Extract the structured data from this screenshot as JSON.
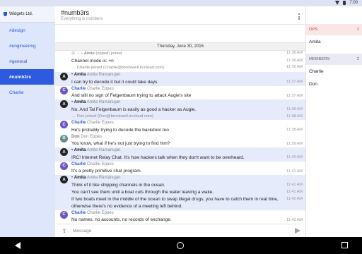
{
  "status": {
    "time": "7:00"
  },
  "server": {
    "name": "Widgets Ltd."
  },
  "channels": [
    {
      "label": "#design"
    },
    {
      "label": "#engineering"
    },
    {
      "label": "#general"
    },
    {
      "label": "#numb3rs"
    },
    {
      "label": "Charlie"
    }
  ],
  "header": {
    "title": "#numb3rs",
    "topic": "Everything is numbers"
  },
  "date_separator": "Thursday, June 30, 2016",
  "messages": {
    "m1": {
      "who": "Amita",
      "text": "(opped) joined",
      "time": "11:36 AM"
    },
    "m2": {
      "text": "Channel mode is: +n",
      "time": "11:36 AM"
    },
    "m3": {
      "text": "Charlie joined (Charlie@brockwell.irccloud.com)",
      "time": "11:36 AM"
    },
    "m4": {
      "avatar": "A",
      "nick": "Amita",
      "real": "Amita Ramanujan",
      "text": "I can try to decode it but it could take days",
      "time": "11:37 AM"
    },
    "m5": {
      "avatar": "C",
      "nick": "Charlie",
      "real": "Charlie Eppes",
      "text": "And still no sign of Felgenbaum trying to attack Augie's site",
      "time": "11:37 AM"
    },
    "m6": {
      "avatar": "A",
      "nick": "Amita",
      "real": "Amita Ramanujan",
      "text": "No. And Tal Felgenbaum is easily as good a hacker as Augie.",
      "time": "11:38 AM"
    },
    "m7": {
      "text": "Don joined (Don@brockwell.irccloud.com)",
      "time": "11:38 AM"
    },
    "m8": {
      "avatar": "C",
      "nick": "Charlie",
      "real": "Charlie Eppes",
      "text": "He's probably trying to decode the backdoor too",
      "time": "11:38 AM"
    },
    "m9": {
      "avatar": "D",
      "nick": "Don",
      "real": "Don Eppes",
      "text": "You know, what if he's not just trying to find him?",
      "time": "11:39 AM"
    },
    "m10": {
      "avatar": "A",
      "nick": "Amita",
      "real": "Amita Ramanujan",
      "text": "IRC! Internet Relay Chat. It's how hackers talk when they don't want to be overheard.",
      "time": "11:40 AM"
    },
    "m11": {
      "avatar": "C",
      "nick": "Charlie",
      "real": "Charlie Eppes",
      "text": "It's a pretty primitive chat program.",
      "time": "11:41 AM"
    },
    "m12": {
      "avatar": "A",
      "nick": "Amita",
      "real": "Amita Ramanujan",
      "text1": "Think of it like shipping channels in the ocean.",
      "time1": "11:41 AM",
      "text2": "You can't see them until a boat cuts through the water leaving a wake.",
      "time2": "11:41 AM",
      "text3": "If two boats meet in the middle of the ocean to swap illegal drugs, you have to catch them in real time,",
      "text4": "otherwise there's no evidence of a meeting left behind.",
      "time3": "11:42 AM"
    },
    "m13": {
      "avatar": "C",
      "nick": "Charlie",
      "real": "Charlie Eppes",
      "text": "No names, no accounts, no records of exchange.",
      "time": "11:42 AM"
    }
  },
  "input": {
    "placeholder": "Message"
  },
  "members": {
    "ops_label": "OPS",
    "ops_count": "1",
    "ops": [
      "Amita"
    ],
    "members_label": "MEMBERS",
    "members_count": "2",
    "members": [
      "Charlie",
      "Don"
    ]
  },
  "colors": {
    "accent": "#2c5be0",
    "sidebar": "#dde6fb",
    "ops": "#c0392b"
  },
  "icons": [
    "wifi-icon",
    "battery-icon",
    "overflow-menu-icon",
    "upload-icon",
    "send-icon",
    "back-icon",
    "home-icon",
    "recents-icon"
  ]
}
